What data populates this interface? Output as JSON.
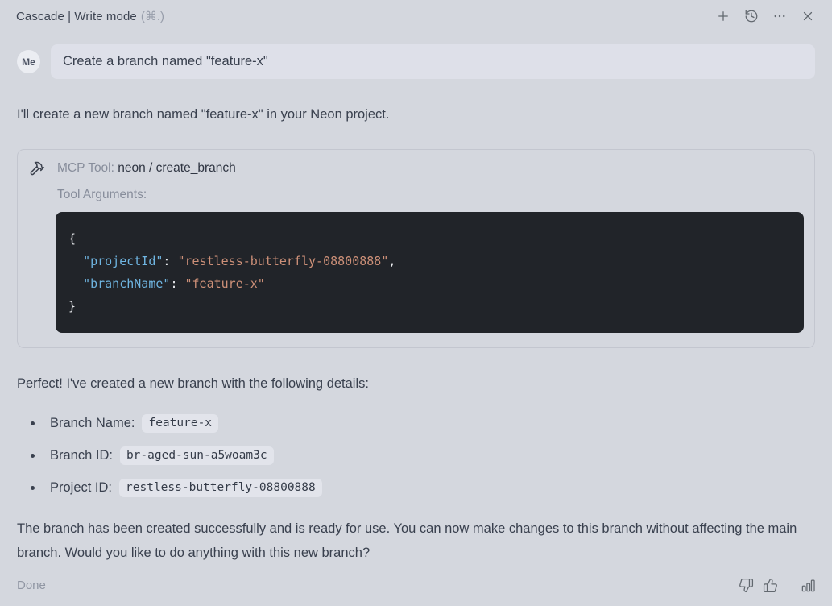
{
  "header": {
    "title": "Cascade | Write mode",
    "shortcut": "(⌘.)",
    "icons": [
      "plus-icon",
      "history-icon",
      "more-icon",
      "close-icon"
    ]
  },
  "user_message": {
    "avatar": "Me",
    "text": "Create a branch named \"feature-x\""
  },
  "assistant": {
    "intro": "I'll create a new branch named \"feature-x\" in your Neon project.",
    "tool_card": {
      "icon": "hammer-icon",
      "label": "MCP Tool:",
      "name": "neon / create_branch",
      "args_label": "Tool Arguments:",
      "code": {
        "open": "{",
        "lines": [
          {
            "indent": "  ",
            "key": "\"projectId\"",
            "sep": ": ",
            "value": "\"restless-butterfly-08800888\"",
            "comma": ","
          },
          {
            "indent": "  ",
            "key": "\"branchName\"",
            "sep": ": ",
            "value": "\"feature-x\"",
            "comma": ""
          }
        ],
        "close": "}"
      }
    },
    "result_intro": "Perfect! I've created a new branch with the following details:",
    "details": [
      {
        "label": "Branch Name:",
        "value": "feature-x"
      },
      {
        "label": "Branch ID:",
        "value": "br-aged-sun-a5woam3c"
      },
      {
        "label": "Project ID:",
        "value": "restless-butterfly-08800888"
      }
    ],
    "closing": "The branch has been created successfully and is ready for use. You can now make changes to this branch without affecting the main branch. Would you like to do anything with this new branch?"
  },
  "footer": {
    "status": "Done",
    "icons": [
      "thumbs-down-icon",
      "thumbs-up-icon",
      "bar-chart-icon"
    ]
  },
  "colors": {
    "page_bg": "#d4d7de",
    "user_bubble_bg": "#dee0e9",
    "code_block_bg": "#212429",
    "code_key": "#6fb5e1",
    "code_string": "#cd9078",
    "inline_code_bg": "#e2e4eb",
    "body_text": "#39404e",
    "secondary_text": "#878d9b"
  }
}
